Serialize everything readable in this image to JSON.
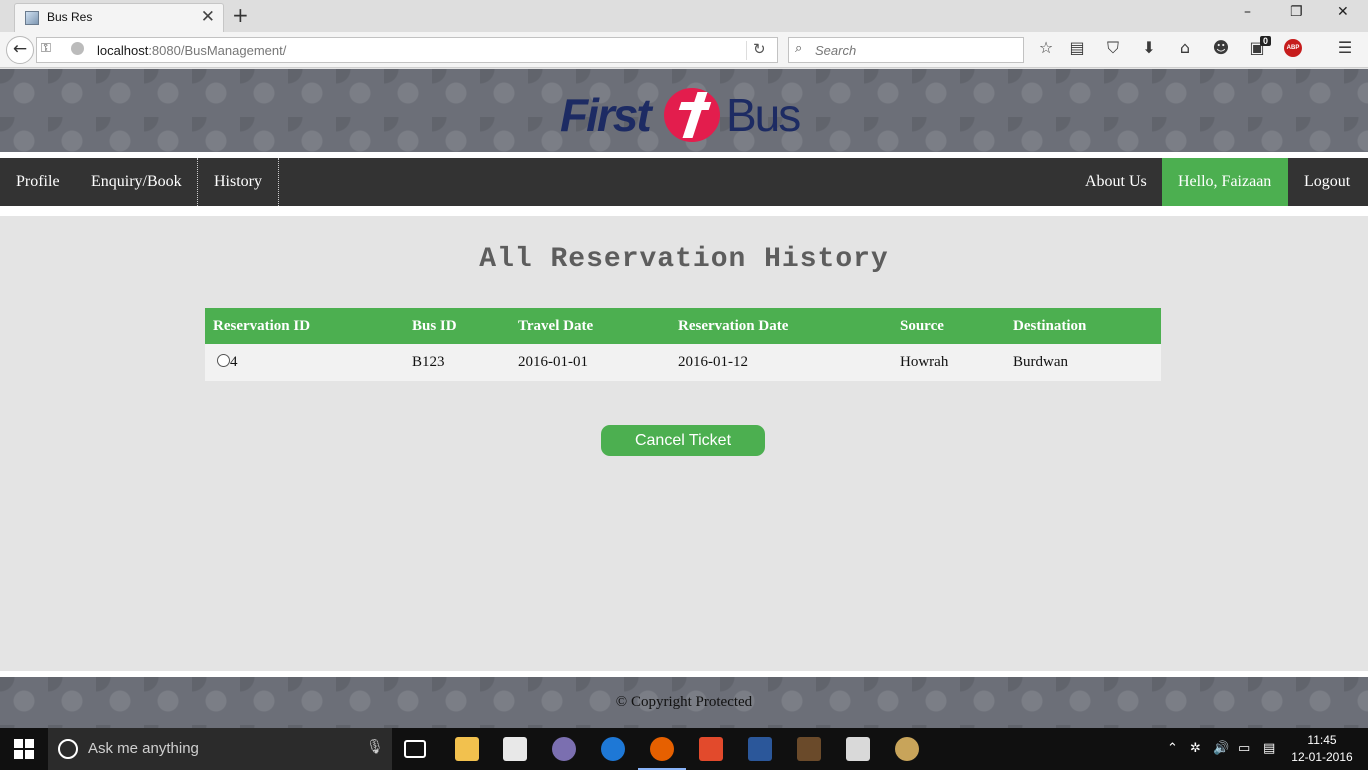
{
  "browser": {
    "tab_title": "Bus Res",
    "tab_close": "✕",
    "new_tab": "+",
    "url_host": "localhost",
    "url_rest": ":8080/BusManagement/",
    "search_placeholder": "Search",
    "window_controls": [
      "–",
      "❐",
      "✕"
    ],
    "toolbar_icons": [
      "star-icon",
      "reading-list-icon",
      "pocket-icon",
      "download-icon",
      "home-icon",
      "chat-icon",
      "extension-icon",
      "adblock-icon",
      "menu-icon"
    ],
    "notification_badge": "0",
    "adblock_label": "ABP"
  },
  "site": {
    "logo_first": "First",
    "logo_bus": "Bus",
    "nav_left": [
      "Profile",
      "Enquiry/Book",
      "History"
    ],
    "nav_right": [
      "About Us",
      "Hello, Faizaan",
      "Logout"
    ],
    "page_title": "All Reservation History",
    "table": {
      "headers": [
        "Reservation ID",
        "Bus ID",
        "Travel Date",
        "Reservation Date",
        "Source",
        "Destination"
      ],
      "rows": [
        [
          "4",
          "B123",
          "2016-01-01",
          "2016-01-12",
          "Howrah",
          "Burdwan"
        ]
      ]
    },
    "cancel_button": "Cancel Ticket",
    "footer": "© Copyright Protected"
  },
  "taskbar": {
    "search_placeholder": "Ask me anything",
    "time": "11:45",
    "date": "12-01-2016"
  },
  "colors": {
    "accent_green": "#4caf50",
    "menu_dark": "#333333",
    "logo_navy": "#1d2b63",
    "logo_red": "#e31d4d"
  }
}
